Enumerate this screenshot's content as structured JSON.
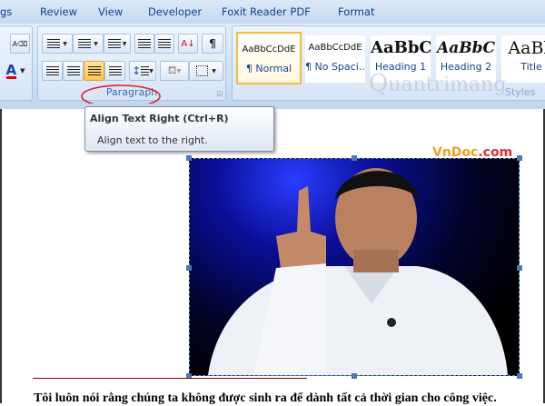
{
  "tabs": [
    "gs",
    "Review",
    "View",
    "Developer",
    "Foxit Reader PDF",
    "Format"
  ],
  "paragraph_group": {
    "label": "Paragraph"
  },
  "styles_group": {
    "label": "Styles",
    "items": [
      {
        "sample": "AaBbCcDdE",
        "name": "¶ Normal",
        "selected": true
      },
      {
        "sample": "AaBbCcDdE",
        "name": "¶ No Spaci..."
      },
      {
        "sample": "AaBbC",
        "name": "Heading 1"
      },
      {
        "sample": "AaBbC",
        "name": "Heading 2"
      },
      {
        "sample": "AaBb",
        "name": "Title"
      }
    ]
  },
  "tooltip": {
    "title": "Align Text Right (Ctrl+R)",
    "description": "Align text to the right."
  },
  "watermarks": {
    "vndoc": "VnDoc.com",
    "quantrimang": "Quantrimang"
  },
  "document": {
    "text": "Tôi luôn nói rằng chúng ta không được sinh ra để dành tất cả thời gian cho công việc."
  },
  "colors": {
    "highlight_ellipse": "#e02020",
    "active_button": "#ffc44d",
    "font_color": "#e00000"
  }
}
